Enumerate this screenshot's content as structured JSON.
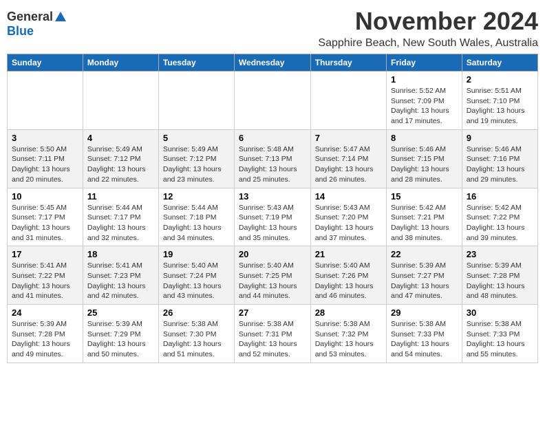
{
  "logo": {
    "general": "General",
    "blue": "Blue"
  },
  "title": "November 2024",
  "location": "Sapphire Beach, New South Wales, Australia",
  "days_of_week": [
    "Sunday",
    "Monday",
    "Tuesday",
    "Wednesday",
    "Thursday",
    "Friday",
    "Saturday"
  ],
  "weeks": [
    [
      {
        "day": "",
        "info": ""
      },
      {
        "day": "",
        "info": ""
      },
      {
        "day": "",
        "info": ""
      },
      {
        "day": "",
        "info": ""
      },
      {
        "day": "",
        "info": ""
      },
      {
        "day": "1",
        "info": "Sunrise: 5:52 AM\nSunset: 7:09 PM\nDaylight: 13 hours and 17 minutes."
      },
      {
        "day": "2",
        "info": "Sunrise: 5:51 AM\nSunset: 7:10 PM\nDaylight: 13 hours and 19 minutes."
      }
    ],
    [
      {
        "day": "3",
        "info": "Sunrise: 5:50 AM\nSunset: 7:11 PM\nDaylight: 13 hours and 20 minutes."
      },
      {
        "day": "4",
        "info": "Sunrise: 5:49 AM\nSunset: 7:12 PM\nDaylight: 13 hours and 22 minutes."
      },
      {
        "day": "5",
        "info": "Sunrise: 5:49 AM\nSunset: 7:12 PM\nDaylight: 13 hours and 23 minutes."
      },
      {
        "day": "6",
        "info": "Sunrise: 5:48 AM\nSunset: 7:13 PM\nDaylight: 13 hours and 25 minutes."
      },
      {
        "day": "7",
        "info": "Sunrise: 5:47 AM\nSunset: 7:14 PM\nDaylight: 13 hours and 26 minutes."
      },
      {
        "day": "8",
        "info": "Sunrise: 5:46 AM\nSunset: 7:15 PM\nDaylight: 13 hours and 28 minutes."
      },
      {
        "day": "9",
        "info": "Sunrise: 5:46 AM\nSunset: 7:16 PM\nDaylight: 13 hours and 29 minutes."
      }
    ],
    [
      {
        "day": "10",
        "info": "Sunrise: 5:45 AM\nSunset: 7:17 PM\nDaylight: 13 hours and 31 minutes."
      },
      {
        "day": "11",
        "info": "Sunrise: 5:44 AM\nSunset: 7:17 PM\nDaylight: 13 hours and 32 minutes."
      },
      {
        "day": "12",
        "info": "Sunrise: 5:44 AM\nSunset: 7:18 PM\nDaylight: 13 hours and 34 minutes."
      },
      {
        "day": "13",
        "info": "Sunrise: 5:43 AM\nSunset: 7:19 PM\nDaylight: 13 hours and 35 minutes."
      },
      {
        "day": "14",
        "info": "Sunrise: 5:43 AM\nSunset: 7:20 PM\nDaylight: 13 hours and 37 minutes."
      },
      {
        "day": "15",
        "info": "Sunrise: 5:42 AM\nSunset: 7:21 PM\nDaylight: 13 hours and 38 minutes."
      },
      {
        "day": "16",
        "info": "Sunrise: 5:42 AM\nSunset: 7:22 PM\nDaylight: 13 hours and 39 minutes."
      }
    ],
    [
      {
        "day": "17",
        "info": "Sunrise: 5:41 AM\nSunset: 7:22 PM\nDaylight: 13 hours and 41 minutes."
      },
      {
        "day": "18",
        "info": "Sunrise: 5:41 AM\nSunset: 7:23 PM\nDaylight: 13 hours and 42 minutes."
      },
      {
        "day": "19",
        "info": "Sunrise: 5:40 AM\nSunset: 7:24 PM\nDaylight: 13 hours and 43 minutes."
      },
      {
        "day": "20",
        "info": "Sunrise: 5:40 AM\nSunset: 7:25 PM\nDaylight: 13 hours and 44 minutes."
      },
      {
        "day": "21",
        "info": "Sunrise: 5:40 AM\nSunset: 7:26 PM\nDaylight: 13 hours and 46 minutes."
      },
      {
        "day": "22",
        "info": "Sunrise: 5:39 AM\nSunset: 7:27 PM\nDaylight: 13 hours and 47 minutes."
      },
      {
        "day": "23",
        "info": "Sunrise: 5:39 AM\nSunset: 7:28 PM\nDaylight: 13 hours and 48 minutes."
      }
    ],
    [
      {
        "day": "24",
        "info": "Sunrise: 5:39 AM\nSunset: 7:28 PM\nDaylight: 13 hours and 49 minutes."
      },
      {
        "day": "25",
        "info": "Sunrise: 5:39 AM\nSunset: 7:29 PM\nDaylight: 13 hours and 50 minutes."
      },
      {
        "day": "26",
        "info": "Sunrise: 5:38 AM\nSunset: 7:30 PM\nDaylight: 13 hours and 51 minutes."
      },
      {
        "day": "27",
        "info": "Sunrise: 5:38 AM\nSunset: 7:31 PM\nDaylight: 13 hours and 52 minutes."
      },
      {
        "day": "28",
        "info": "Sunrise: 5:38 AM\nSunset: 7:32 PM\nDaylight: 13 hours and 53 minutes."
      },
      {
        "day": "29",
        "info": "Sunrise: 5:38 AM\nSunset: 7:33 PM\nDaylight: 13 hours and 54 minutes."
      },
      {
        "day": "30",
        "info": "Sunrise: 5:38 AM\nSunset: 7:33 PM\nDaylight: 13 hours and 55 minutes."
      }
    ]
  ]
}
